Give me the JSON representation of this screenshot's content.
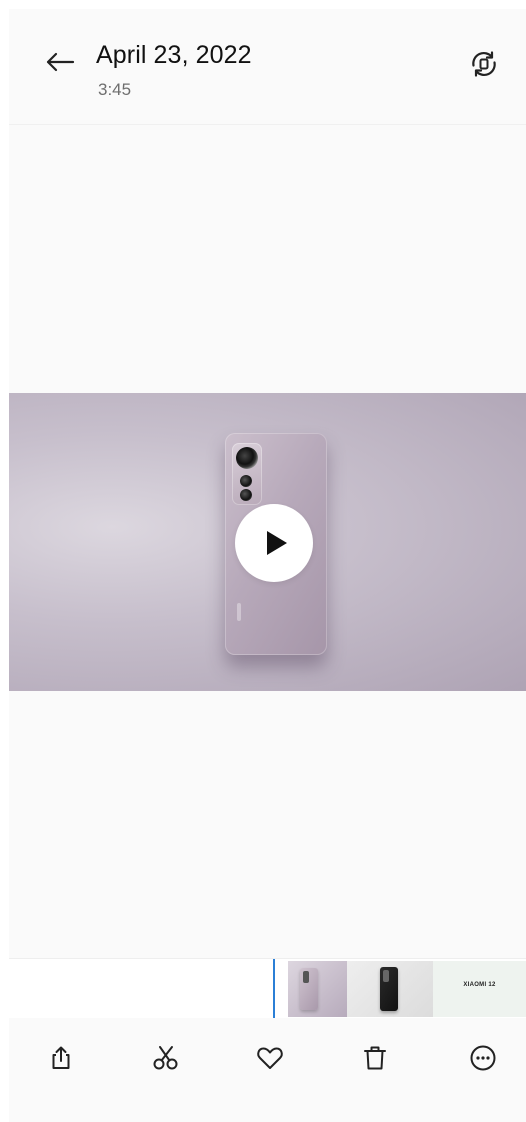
{
  "header": {
    "title": "April 23, 2022",
    "subtitle": "3:45",
    "back_icon": "arrow-left-icon",
    "rotate_icon": "rotate-screen-icon"
  },
  "media": {
    "type": "video",
    "play_icon": "play-icon"
  },
  "filmstrip": {
    "thumbnails": [
      {
        "name": "video-thumbnail-current"
      },
      {
        "name": "photo-thumbnail-black-phone"
      },
      {
        "name": "photo-thumbnail-xiaomi",
        "text": "XIAOMI 12"
      }
    ],
    "playhead_color": "#2b7fd6"
  },
  "toolbar": {
    "items": [
      {
        "name": "share",
        "icon": "share-icon"
      },
      {
        "name": "edit-cut",
        "icon": "scissors-icon"
      },
      {
        "name": "favorite",
        "icon": "heart-icon"
      },
      {
        "name": "delete",
        "icon": "trash-icon"
      },
      {
        "name": "more",
        "icon": "more-icon"
      }
    ]
  },
  "colors": {
    "background": "#fafafa",
    "text_primary": "#111111",
    "text_secondary": "#6e6e6e"
  }
}
